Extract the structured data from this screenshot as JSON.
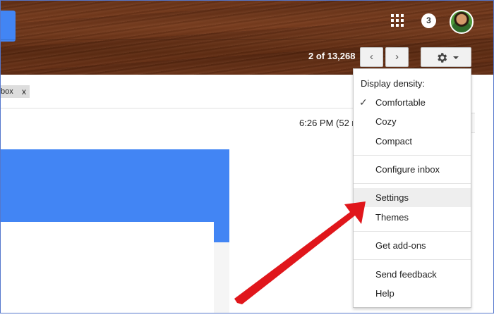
{
  "header": {
    "notification_count": "3",
    "pager": {
      "text": "2 of 13,268",
      "prev_glyph": "‹",
      "next_glyph": "›"
    }
  },
  "toolbar": {
    "label_chip": "box",
    "label_chip_remove": "x"
  },
  "message": {
    "time": "6:26 PM (52 r"
  },
  "settings_menu": {
    "heading": "Display density:",
    "density_options": [
      {
        "label": "Comfortable",
        "checked": true
      },
      {
        "label": "Cozy",
        "checked": false
      },
      {
        "label": "Compact",
        "checked": false
      }
    ],
    "check_glyph": "✓",
    "items": [
      {
        "label": "Configure inbox"
      },
      {
        "label": "Settings",
        "highlighted": true
      },
      {
        "label": "Themes"
      },
      {
        "label": "Get add-ons"
      },
      {
        "label": "Send feedback"
      },
      {
        "label": "Help"
      }
    ]
  },
  "colors": {
    "accent_blue": "#4285f4",
    "arrow_red": "#e0161b"
  },
  "icons": [
    "apps-icon",
    "gear-icon",
    "chevron-left-icon",
    "chevron-right-icon",
    "avatar",
    "red-arrow-annotation"
  ]
}
